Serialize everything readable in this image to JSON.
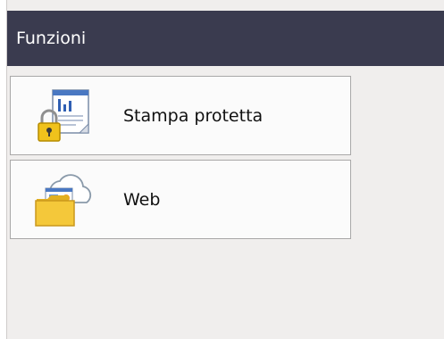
{
  "header": {
    "title": "Funzioni"
  },
  "menu": {
    "items": [
      {
        "label": "Stampa protetta",
        "icon": "secure-print-icon"
      },
      {
        "label": "Web",
        "icon": "web-folder-icon"
      }
    ]
  },
  "colors": {
    "header_bg": "#3a3b4f",
    "screen_bg": "#f0eeed",
    "item_bg": "#fbfbfb",
    "lock_yellow": "#f0c21c"
  }
}
